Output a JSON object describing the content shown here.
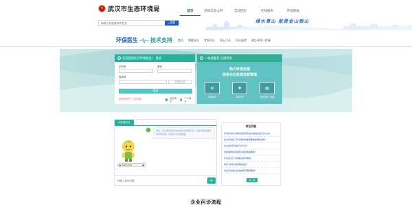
{
  "header": {
    "site_title": "武汉市生态环境局",
    "nav": [
      "首页",
      "新闻信息公开",
      "互动回应",
      "在线服务",
      "环境数据"
    ],
    "active_index": 0
  },
  "search": {
    "placeholder": "请输入您要查询的信息",
    "button_label": "搜索"
  },
  "banner": {
    "slogan": "绿水青山 就是金山银山"
  },
  "section": {
    "brand_1": "环保医生",
    "brand_2": "技术支持",
    "subnav": [
      "首页",
      "智能导诊",
      "专家问诊",
      "网上门诊",
      "问诊经验",
      "政企环保一件事"
    ],
    "active_index": 0
  },
  "login": {
    "heading": "欢迎使用武汉环保医生！ 登录",
    "username_label": "手机号",
    "username_placeholder": "",
    "password_label": "密码",
    "password_placeholder": "",
    "code_label": "验证码",
    "code_placeholder": "",
    "code_button": "获取验证码",
    "submit": "登录",
    "register": "还没有账号？ 立即注册",
    "radio_1": "企业用户",
    "radio_2": "个人用户"
  },
  "service": {
    "heading": "一站式服务 在线咨询",
    "title": "助力环境治理",
    "subtitle": "促进企业实现自我管理",
    "items": [
      "智能问诊",
      "专家问诊",
      "政企环保一件事"
    ]
  },
  "chat": {
    "tab": "AI在线问诊",
    "greeting": "你好，欢迎使用武汉市生态环境智能问诊！请告诉我您遇到的环保问题，我将尽力为您解答。",
    "audio_label": "0:00 / 0:00",
    "input_placeholder": "请输入你的问题",
    "send_icon": "send-icon"
  },
  "faq": {
    "title": "常见问题",
    "items": [
      "环境影响评价审批后项目建设内容发生变化怎么办？",
      "建设项目竣工环境保护验收需要准备哪些材料？",
      "企业如何申请排污许可证？",
      "危险废物贮存场所应满足哪些要求？",
      "环境违法行为举报途径有哪些？",
      "噪声污染防治有哪些规定？",
      "企业环境信息依法披露有哪些要求？"
    ],
    "change_button": "换一换"
  },
  "footer": {
    "title": "企业问诊流程"
  }
}
